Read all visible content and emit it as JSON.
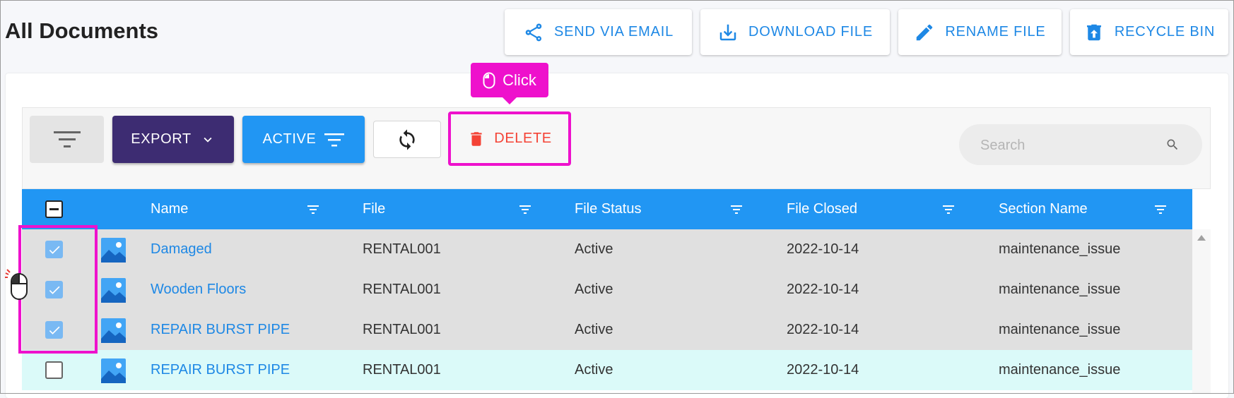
{
  "page": {
    "title": "All Documents"
  },
  "top_actions": [
    {
      "label": "SEND VIA EMAIL",
      "icon": "share-icon"
    },
    {
      "label": "DOWNLOAD FILE",
      "icon": "download-icon"
    },
    {
      "label": "RENAME FILE",
      "icon": "pencil-icon"
    },
    {
      "label": "RECYCLE BIN",
      "icon": "recycle-bin-icon"
    }
  ],
  "toolbar": {
    "export_label": "EXPORT",
    "active_label": "ACTIVE",
    "delete_label": "DELETE",
    "search_placeholder": "Search",
    "search_value": ""
  },
  "tooltip": {
    "label": "Click"
  },
  "table": {
    "columns": [
      "Name",
      "File",
      "File Status",
      "File Closed",
      "Section Name"
    ],
    "rows": [
      {
        "selected": true,
        "name": "Damaged",
        "file": "RENTAL001",
        "status": "Active",
        "closed": "2022-10-14",
        "section": "maintenance_issue"
      },
      {
        "selected": true,
        "name": "Wooden Floors",
        "file": "RENTAL001",
        "status": "Active",
        "closed": "2022-10-14",
        "section": "maintenance_issue"
      },
      {
        "selected": true,
        "name": "REPAIR BURST PIPE",
        "file": "RENTAL001",
        "status": "Active",
        "closed": "2022-10-14",
        "section": "maintenance_issue"
      },
      {
        "selected": false,
        "name": "REPAIR BURST PIPE",
        "file": "RENTAL001",
        "status": "Active",
        "closed": "2022-10-14",
        "section": "maintenance_issue"
      }
    ]
  },
  "colors": {
    "accent": "#2196f3",
    "export_bg": "#3d2c72",
    "delete": "#f44336",
    "highlight": "#ee11cc",
    "selected_row": "#e0e0e0",
    "unselected_row": "#dbfaf9"
  }
}
